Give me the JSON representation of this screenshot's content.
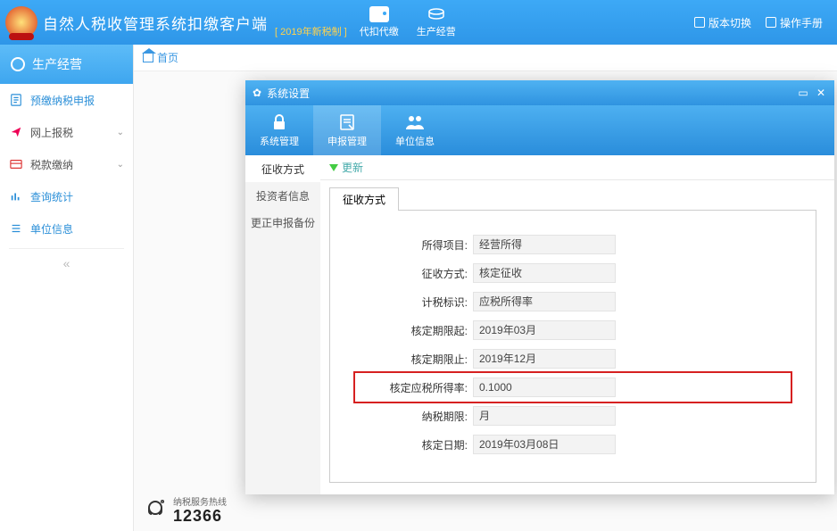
{
  "header": {
    "app_title": "自然人税收管理系统扣缴客户端",
    "new_rule": "[ 2019年新税制 ]",
    "tool1": "代扣代缴",
    "tool2": "生产经营",
    "link1": "版本切换",
    "link2": "操作手册"
  },
  "sidebar": {
    "header": "生产经营",
    "items": [
      "预缴纳税申报",
      "网上报税",
      "税款缴纳",
      "查询统计",
      "单位信息"
    ]
  },
  "crumb": {
    "home": "首页"
  },
  "dialog": {
    "title": "系统设置",
    "tabs": [
      "系统管理",
      "申报管理",
      "单位信息"
    ],
    "left_menu": [
      "征收方式",
      "投资者信息",
      "更正申报备份"
    ],
    "update": "更新",
    "inner_tab": "征收方式",
    "form": {
      "rows": [
        {
          "label": "所得项目:",
          "value": "经营所得"
        },
        {
          "label": "征收方式:",
          "value": "核定征收"
        },
        {
          "label": "计税标识:",
          "value": "应税所得率"
        },
        {
          "label": "核定期限起:",
          "value": "2019年03月"
        },
        {
          "label": "核定期限止:",
          "value": "2019年12月"
        },
        {
          "label": "核定应税所得率:",
          "value": "0.1000",
          "highlight": true
        },
        {
          "label": "纳税期限:",
          "value": "月"
        },
        {
          "label": "核定日期:",
          "value": "2019年03月08日"
        }
      ]
    }
  },
  "hotline": {
    "label": "纳税服务热线",
    "number": "12366"
  }
}
